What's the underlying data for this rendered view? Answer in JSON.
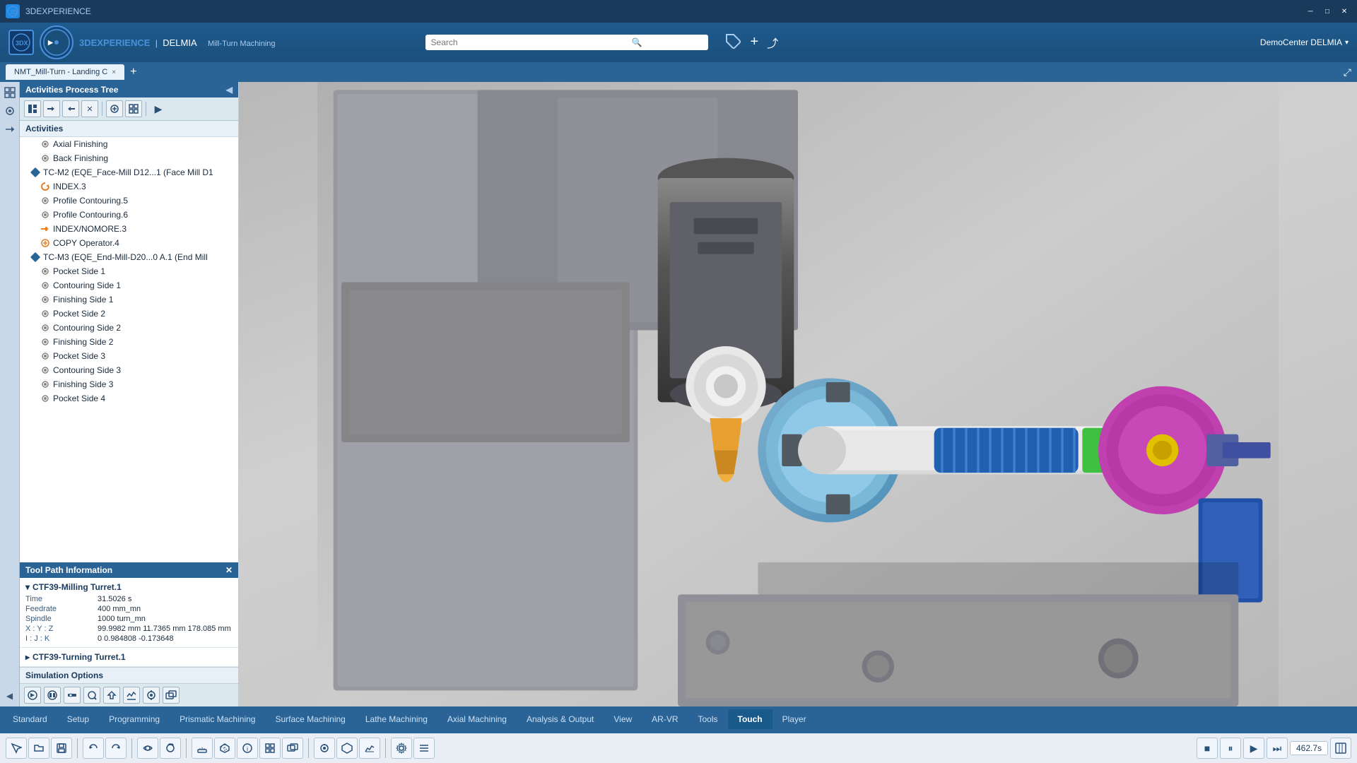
{
  "titlebar": {
    "title": "3DEXPERIENCE",
    "icon_label": "3DX"
  },
  "header": {
    "brand_3dx": "3DEXPERIENCE",
    "brand_separator": "|",
    "brand_delmia": "DELMIA",
    "brand_product": "Mill-Turn Machining",
    "search_placeholder": "Search",
    "bookmark_icon": "🏷",
    "user_label": "DemoCenter DELMIA",
    "user_arrow": "▾",
    "action_plus": "+",
    "action_share": "↗",
    "action_expand": "⤢"
  },
  "tab": {
    "label": "NMT_Mill-Turn - Landing C",
    "close": "×",
    "add": "+"
  },
  "panel_header": {
    "title": "Activities Process Tree",
    "collapse": "◀"
  },
  "activities_label": "Activities",
  "toolbar_icons": [
    "≡",
    "←",
    "→",
    "✕",
    "⊕",
    "⊞",
    "▶"
  ],
  "tree_items": [
    {
      "indent": 2,
      "icon": "⚙",
      "icon_color": "#888",
      "label": "Axial Finishing",
      "level": 3
    },
    {
      "indent": 2,
      "icon": "⚙",
      "icon_color": "#888",
      "label": "Back Finishing",
      "level": 3
    },
    {
      "indent": 1,
      "icon": "🔷",
      "icon_color": "#2a6496",
      "label": "TC-M2 (EQE_Face-Mill D12...1 (Face Mill D1",
      "level": 2
    },
    {
      "indent": 2,
      "icon": "↺",
      "icon_color": "#e67e22",
      "label": "INDEX.3",
      "level": 3
    },
    {
      "indent": 2,
      "icon": "⚙",
      "icon_color": "#888",
      "label": "Profile Contouring.5",
      "level": 3
    },
    {
      "indent": 2,
      "icon": "⚙",
      "icon_color": "#888",
      "label": "Profile Contouring.6",
      "level": 3
    },
    {
      "indent": 2,
      "icon": "→→",
      "icon_color": "#e67e22",
      "label": "INDEX/NOMORE.3",
      "level": 3
    },
    {
      "indent": 2,
      "icon": "⊕",
      "icon_color": "#e67e22",
      "label": "COPY Operator.4",
      "level": 3
    },
    {
      "indent": 1,
      "icon": "🔷",
      "icon_color": "#2a6496",
      "label": "TC-M3 (EQE_End-Mill-D20...0 A.1 (End Mill",
      "level": 2
    },
    {
      "indent": 2,
      "icon": "⚙",
      "icon_color": "#888",
      "label": "Pocket Side 1",
      "level": 3
    },
    {
      "indent": 2,
      "icon": "⚙",
      "icon_color": "#888",
      "label": "Contouring Side 1",
      "level": 3
    },
    {
      "indent": 2,
      "icon": "⚙",
      "icon_color": "#888",
      "label": "Finishing Side 1",
      "level": 3
    },
    {
      "indent": 2,
      "icon": "⚙",
      "icon_color": "#888",
      "label": "Pocket Side 2",
      "level": 3
    },
    {
      "indent": 2,
      "icon": "⚙",
      "icon_color": "#888",
      "label": "Contouring Side 2",
      "level": 3
    },
    {
      "indent": 2,
      "icon": "⚙",
      "icon_color": "#888",
      "label": "Finishing Side 2",
      "level": 3
    },
    {
      "indent": 2,
      "icon": "⚙",
      "icon_color": "#888",
      "label": "Pocket Side 3",
      "level": 3
    },
    {
      "indent": 2,
      "icon": "⚙",
      "icon_color": "#888",
      "label": "Contouring Side 3",
      "level": 3
    },
    {
      "indent": 2,
      "icon": "⚙",
      "icon_color": "#888",
      "label": "Finishing Side 3",
      "level": 3
    },
    {
      "indent": 2,
      "icon": "⚙",
      "icon_color": "#888",
      "label": "Pocket Side 4",
      "level": 3
    }
  ],
  "toolpath_panel_title": "Tool Path Information",
  "toolpath_section1": {
    "title": "CTF39-Milling Turret.1",
    "fields": {
      "time_label": "Time",
      "time_value": "31.5026 s",
      "feedrate_label": "Feedrate",
      "feedrate_value": "400 mm_mn",
      "spindle_label": "Spindle",
      "spindle_value": "1000 turn_mn",
      "xyz_label": "X : Y : Z",
      "xyz_value": "99.9982 mm  11.7365 mm  178.085 mm",
      "ijk_label": "I : J : K",
      "ijk_value": "0  0.984808  -0.173648"
    }
  },
  "toolpath_section2": {
    "title": "CTF39-Turning Turret.1"
  },
  "sim_options_label": "Simulation Options",
  "bottom_tabs": [
    {
      "label": "Standard",
      "active": false
    },
    {
      "label": "Setup",
      "active": false
    },
    {
      "label": "Programming",
      "active": false
    },
    {
      "label": "Prismatic Machining",
      "active": false
    },
    {
      "label": "Surface Machining",
      "active": false
    },
    {
      "label": "Lathe Machining",
      "active": false
    },
    {
      "label": "Axial Machining",
      "active": false
    },
    {
      "label": "Analysis & Output",
      "active": false
    },
    {
      "label": "View",
      "active": false
    },
    {
      "label": "AR-VR",
      "active": false
    },
    {
      "label": "Tools",
      "active": false
    },
    {
      "label": "Touch",
      "active": true
    },
    {
      "label": "Player",
      "active": false
    }
  ],
  "playback": {
    "speed_value": "462.7s",
    "stop_icon": "■",
    "pause_icon": "⏸",
    "play_icon": "▶",
    "ff_icon": "⏭"
  }
}
